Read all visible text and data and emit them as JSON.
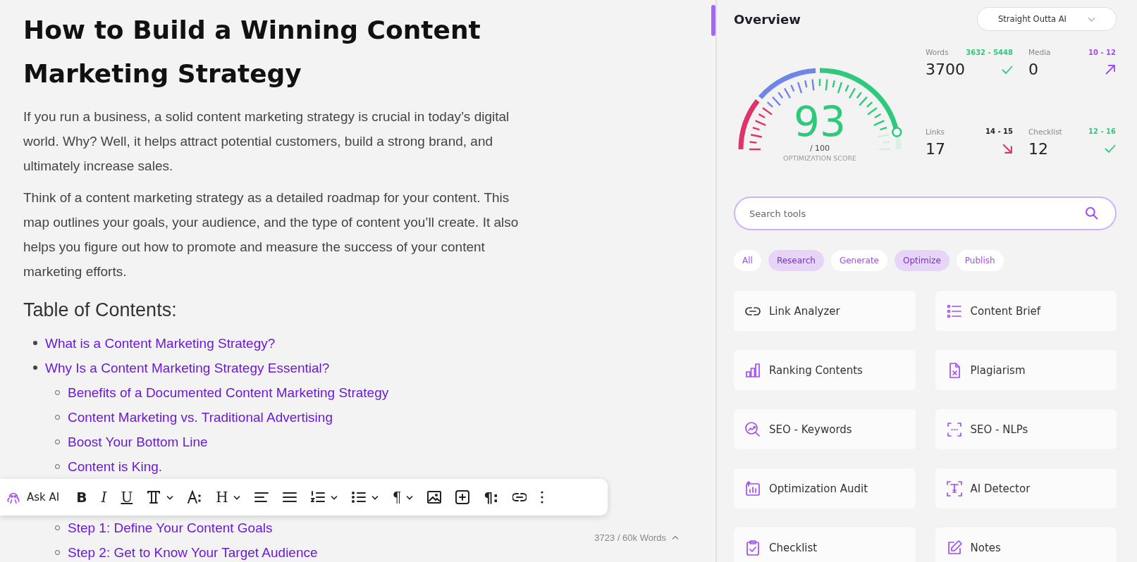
{
  "editor": {
    "title": "How to Build a Winning Content Marketing Strategy",
    "paragraphs": [
      "If you run a business, a solid content marketing strategy is crucial in today’s digital world. Why? Well, it helps attract potential customers, build a strong brand, and ultimately increase sales.",
      "Think of a content marketing strategy as a detailed roadmap for your content. This map outlines your goals, your audience, and the type of content you’ll create. It also helps you figure out how to promote and measure the success of your content marketing efforts."
    ],
    "toc_heading": "Table of Contents:",
    "toc": [
      {
        "label": "What is a Content Marketing Strategy?"
      },
      {
        "label": "Why Is a Content Marketing Strategy Essential?",
        "children": [
          {
            "label": "Benefits of a Documented Content Marketing Strategy"
          },
          {
            "label": "Content Marketing vs. Traditional Advertising"
          },
          {
            "label": "Boost Your Bottom Line"
          },
          {
            "label": "Content is King."
          },
          {
            "label": "Step 1: Define Your Content Goals"
          },
          {
            "label": "Step 2: Get to Know Your Target Audience"
          }
        ]
      }
    ],
    "word_count": "3723 / 60k Words"
  },
  "toolbar": [
    {
      "kind": "ai",
      "label": "Ask AI"
    },
    {
      "kind": "bold",
      "label": "B"
    },
    {
      "kind": "italic",
      "label": "I"
    },
    {
      "kind": "underline",
      "label": "U"
    },
    {
      "kind": "font"
    },
    {
      "kind": "size"
    },
    {
      "kind": "heading",
      "label": "H"
    },
    {
      "kind": "align"
    },
    {
      "kind": "justify"
    },
    {
      "kind": "olist"
    },
    {
      "kind": "ulist"
    },
    {
      "kind": "paragraph",
      "label": "¶"
    },
    {
      "kind": "image"
    },
    {
      "kind": "plus"
    },
    {
      "kind": "marks",
      "label": "¶:"
    },
    {
      "kind": "link"
    },
    {
      "kind": "more"
    }
  ],
  "overview": {
    "title": "Overview",
    "dropdown": "Straight Outta AI",
    "gauge": {
      "score": "93",
      "max": "/ 100",
      "label": "OPTIMIZATION SCORE"
    },
    "stats": [
      {
        "label": "Words",
        "range": "3632 - 5448",
        "value": "3700",
        "kind": "ok"
      },
      {
        "label": "Media",
        "range": "10 - 12",
        "value": "0",
        "kind": "up"
      },
      {
        "label": "Links",
        "range": "14 - 15",
        "value": "17",
        "kind": "down"
      },
      {
        "label": "Checklist",
        "range": "12 - 16",
        "value": "12",
        "kind": "ok"
      }
    ]
  },
  "search": {
    "placeholder": "Search tools"
  },
  "filters": [
    {
      "label": "All",
      "selected": false
    },
    {
      "label": "Research",
      "selected": true
    },
    {
      "label": "Generate",
      "selected": false
    },
    {
      "label": "Optimize",
      "selected": true
    },
    {
      "label": "Publish",
      "selected": false
    }
  ],
  "tools": [
    {
      "label": "Link Analyzer",
      "kind": "link"
    },
    {
      "label": "Content Brief",
      "kind": "list"
    },
    {
      "label": "Ranking Contents",
      "kind": "bars"
    },
    {
      "label": "Plagiarism",
      "kind": "docx"
    },
    {
      "label": "SEO - Keywords",
      "kind": "trend"
    },
    {
      "label": "SEO - NLPs",
      "kind": "frame"
    },
    {
      "label": "Optimization Audit",
      "kind": "audit"
    },
    {
      "label": "AI Detector",
      "kind": "scan"
    },
    {
      "label": "Checklist",
      "kind": "clip"
    },
    {
      "label": "Notes",
      "kind": "edit"
    }
  ]
}
